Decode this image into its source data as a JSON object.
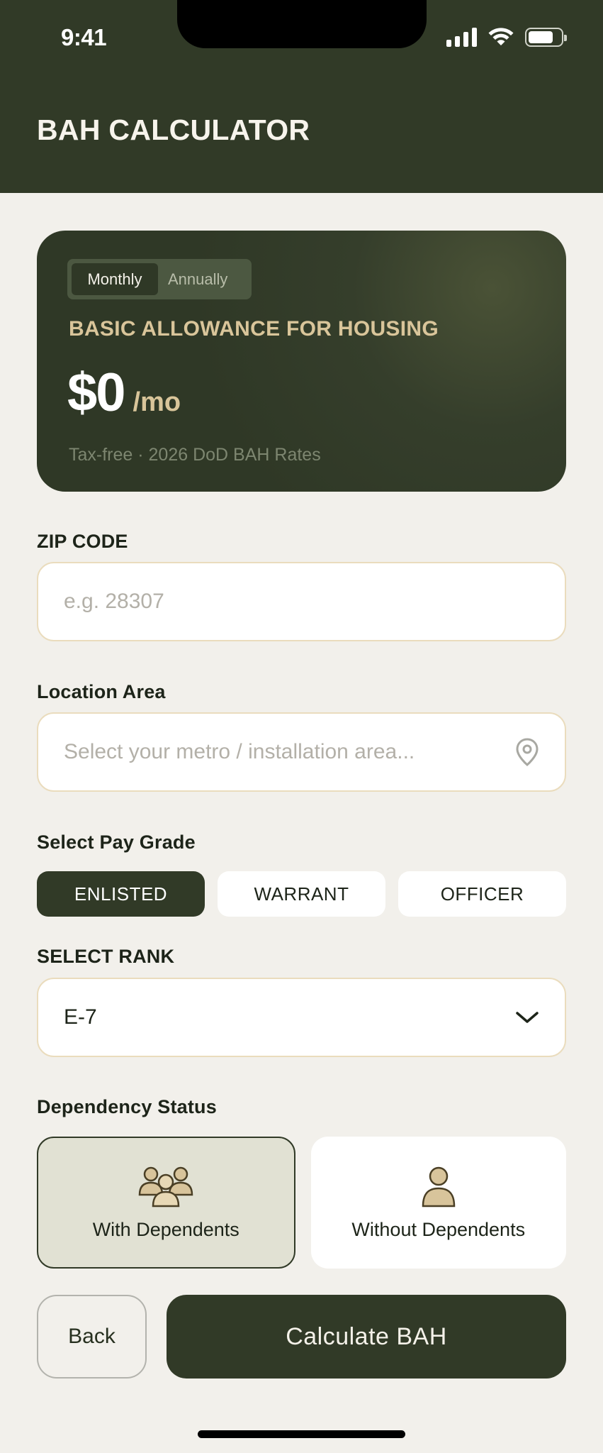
{
  "status_bar": {
    "time": "9:41"
  },
  "header": {
    "title": "BAH CALCULATOR"
  },
  "hero": {
    "period_options": [
      "Monthly",
      "Annually"
    ],
    "period_selected": "Monthly",
    "label": "BASIC ALLOWANCE FOR HOUSING",
    "amount": "$0",
    "unit": "/mo",
    "note": "Tax-free · 2026 DoD BAH Rates"
  },
  "zip": {
    "label": "ZIP CODE",
    "placeholder": "e.g. 28307"
  },
  "location": {
    "label": "Location Area",
    "placeholder": "Select your metro / installation area..."
  },
  "pay_grade": {
    "label": "Select Pay Grade",
    "options": [
      "ENLISTED",
      "WARRANT",
      "OFFICER"
    ],
    "selected": "ENLISTED"
  },
  "rank": {
    "label": "SELECT RANK",
    "value": "E-7"
  },
  "dependency": {
    "label": "Dependency Status",
    "options": [
      "With Dependents",
      "Without Dependents"
    ],
    "selected": "With Dependents"
  },
  "actions": {
    "back": "Back",
    "calculate": "Calculate BAH"
  },
  "colors": {
    "primary": "#313a27",
    "accent_tan": "#d9c59a",
    "background": "#f2f0eb",
    "input_border": "#eadcbd"
  }
}
